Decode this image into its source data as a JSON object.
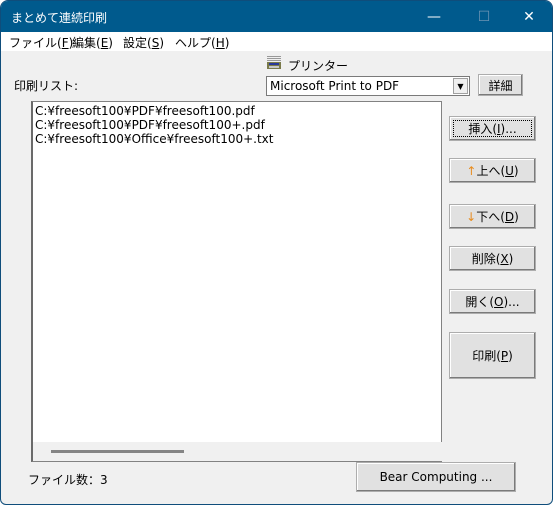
{
  "window": {
    "title": "まとめて連続印刷",
    "controls": {
      "minimize": "—",
      "maximize": "☐",
      "close": "✕"
    }
  },
  "menu": [
    {
      "label": "ファイル(",
      "key": "F",
      "tail": ")"
    },
    {
      "label": "編集(",
      "key": "E",
      "tail": ")"
    },
    {
      "label": "設定(",
      "key": "S",
      "tail": ")"
    },
    {
      "label": "ヘルプ(",
      "key": "H",
      "tail": ")"
    }
  ],
  "print_list_label": "印刷リスト:",
  "printer": {
    "label": "プリンター",
    "selected": "Microsoft Print to PDF",
    "details_button": "詳細"
  },
  "files": [
    "C:¥freesoft100¥PDF¥freesoft100.pdf",
    "C:¥freesoft100¥PDF¥freesoft100+.pdf",
    "C:¥freesoft100¥Office¥freesoft100+.txt"
  ],
  "buttons": {
    "insert": {
      "pre": "挿入(",
      "key": "I",
      "post": ")..."
    },
    "up": {
      "arrow": "↑",
      "pre": "上へ(",
      "key": "U",
      "post": ")"
    },
    "down": {
      "arrow": "↓",
      "pre": "下へ(",
      "key": "D",
      "post": ")"
    },
    "delete": {
      "pre": "削除(",
      "key": "X",
      "post": ")"
    },
    "open": {
      "pre": "開く(",
      "key": "O",
      "post": ")..."
    },
    "print": {
      "pre": "印刷(",
      "key": "P",
      "post": ")"
    },
    "about": "Bear Computing ..."
  },
  "status": {
    "file_count": "ファイル数：3"
  }
}
